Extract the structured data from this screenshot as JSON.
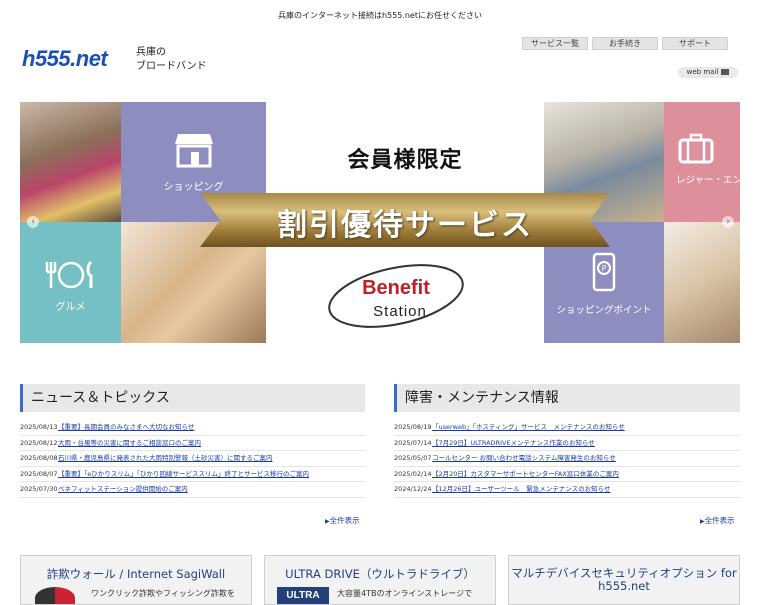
{
  "header": {
    "tagline": "兵庫のインターネット接続はh555.netにお任せください",
    "logo": "h555.net",
    "logo_sub_1": "兵庫の",
    "logo_sub_2": "ブロードバンド",
    "nav": [
      "サービス一覧",
      "お手続き",
      "サポート"
    ],
    "webmail": "web mail"
  },
  "banner": {
    "title": "会員様限定",
    "ribbon": "割引優待サービス",
    "brand_1": "Benefit",
    "brand_2": "Station",
    "tiles": {
      "shopping": "ショッピング",
      "gourmet": "グルメ",
      "leisure": "レジャー・エンタメ",
      "points": "ショッピングポイント"
    },
    "colors": {
      "lavender": "#8e8dc0",
      "teal": "#75c0c4",
      "pink": "#de8f9c",
      "gold": "#c7a65f"
    }
  },
  "news": {
    "heading": "ニュース＆トピックス",
    "items": [
      {
        "date": "2025/08/13",
        "text": "【重要】長期会員のみなさまへ大切なお知らせ"
      },
      {
        "date": "2025/08/12",
        "text": "大雨・台風等の災害に関するご相談窓口のご案内"
      },
      {
        "date": "2025/08/08",
        "text": "石川県・鹿児島県に発表された大雨特別警報（土砂災害）に関するご案内"
      },
      {
        "date": "2025/08/07",
        "text": "【重要】「eひかりスリム」「ひかり回線サービススリム」終了とサービス移行のご案内"
      },
      {
        "date": "2025/07/30",
        "text": "ベネフィットステーション提供開始のご案内"
      }
    ],
    "more": "全件表示"
  },
  "maintenance": {
    "heading": "障害・メンテナンス情報",
    "items": [
      {
        "date": "2025/08/19",
        "text": "「userweb」「ホスティング」サービス　メンテナンスのお知らせ"
      },
      {
        "date": "2025/07/14",
        "text": "【7月29日】ULTRADRIVEメンテナンス作業のお知らせ"
      },
      {
        "date": "2025/05/07",
        "text": "コールセンター お問い合わせ電話システム障害発生のお知らせ"
      },
      {
        "date": "2025/02/14",
        "text": "【2月20日】カスタマーサポートセンターFAX窓口休業のご案内"
      },
      {
        "date": "2024/12/24",
        "text": "【12月26日】ユーザーツール　緊急メンテナンスのお知らせ"
      }
    ],
    "more": "全件表示"
  },
  "promos": [
    {
      "title": "詐欺ウォール / Internet SagiWall",
      "desc": "ワンクリック詐欺やフィッシング詐欺を"
    },
    {
      "title": "ULTRA DRIVE（ウルトラドライブ）",
      "desc": "大容量4TBのオンラインストレージで",
      "badge": "ULTRA"
    },
    {
      "title_1": "マルチデバイスセキュリティオプション for",
      "title_2": "h555.net"
    }
  ]
}
